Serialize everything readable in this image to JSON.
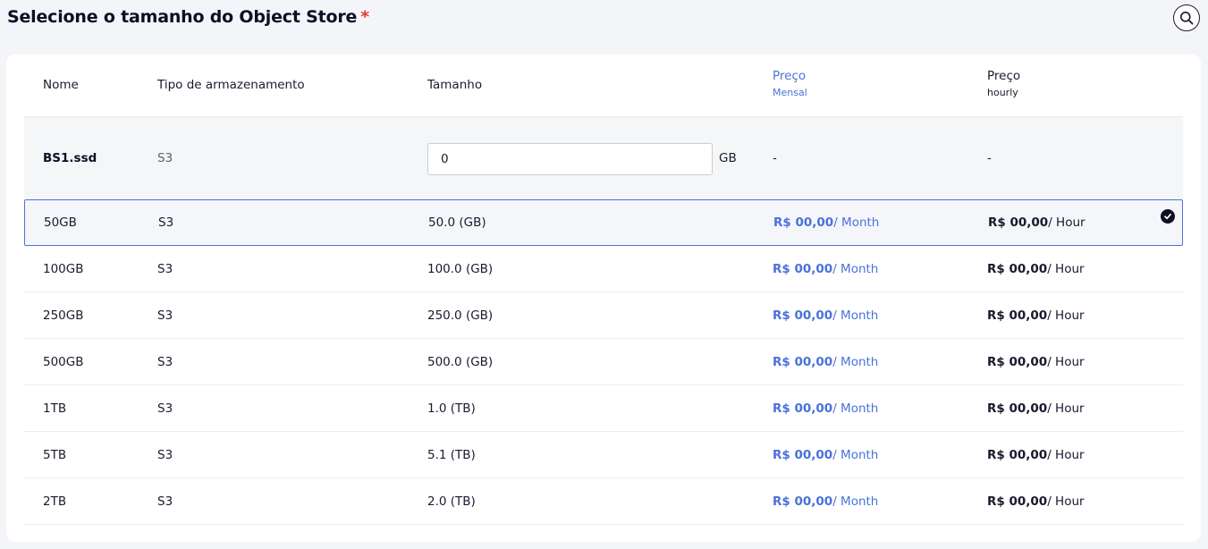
{
  "title": "Selecione o tamanho do Object Store",
  "required_marker": "*",
  "columns": {
    "name": "Nome",
    "storage_type": "Tipo de armazenamento",
    "size": "Tamanho",
    "price_month": "Preço",
    "price_month_sub": "Mensal",
    "price_hour": "Preço",
    "price_hour_sub": "hourly"
  },
  "custom_row": {
    "name": "BS1.ssd",
    "type": "S3",
    "size_value": "0",
    "unit": "GB",
    "price_month": "-",
    "price_hour": "-"
  },
  "rows": [
    {
      "name": "50GB",
      "type": "S3",
      "size": "50.0 (GB)",
      "price_month": "R$ 00,00",
      "month_suffix": "/ Month",
      "price_hour": "R$ 00,00",
      "hour_suffix": "/ Hour",
      "selected": true
    },
    {
      "name": "100GB",
      "type": "S3",
      "size": "100.0 (GB)",
      "price_month": "R$ 00,00",
      "month_suffix": "/ Month",
      "price_hour": "R$ 00,00",
      "hour_suffix": "/ Hour"
    },
    {
      "name": "250GB",
      "type": "S3",
      "size": "250.0 (GB)",
      "price_month": "R$ 00,00",
      "month_suffix": "/ Month",
      "price_hour": "R$ 00,00",
      "hour_suffix": "/ Hour"
    },
    {
      "name": "500GB",
      "type": "S3",
      "size": "500.0 (GB)",
      "price_month": "R$ 00,00",
      "month_suffix": "/ Month",
      "price_hour": "R$ 00,00",
      "hour_suffix": "/ Hour"
    },
    {
      "name": "1TB",
      "type": "S3",
      "size": "1.0 (TB)",
      "price_month": "R$ 00,00",
      "month_suffix": "/ Month",
      "price_hour": "R$ 00,00",
      "hour_suffix": "/ Hour"
    },
    {
      "name": "5TB",
      "type": "S3",
      "size": "5.1 (TB)",
      "price_month": "R$ 00,00",
      "month_suffix": "/ Month",
      "price_hour": "R$ 00,00",
      "hour_suffix": "/ Hour"
    },
    {
      "name": "2TB",
      "type": "S3",
      "size": "2.0 (TB)",
      "price_month": "R$ 00,00",
      "month_suffix": "/ Month",
      "price_hour": "R$ 00,00",
      "hour_suffix": "/ Hour"
    }
  ],
  "colors": {
    "accent": "#4a72d9",
    "required": "#e53935",
    "text": "#1a1a2e"
  },
  "icons": {
    "search": "search-icon",
    "selected": "check-circle-icon"
  }
}
